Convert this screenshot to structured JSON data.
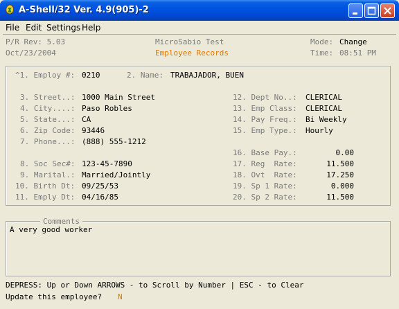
{
  "window": {
    "title": "A-Shell/32 Ver. 4.9(905)-2"
  },
  "menu": {
    "file": "File",
    "edit": "Edit",
    "settings": "Settings",
    "help": "Help"
  },
  "header": {
    "prrev": "P/R Rev: 5.03",
    "date": "Oct/23/2004",
    "company": "MicroSabio Test",
    "module": "Employee Records",
    "mode_label": "Mode:",
    "mode_value": "Change",
    "time_label": "Time:",
    "time_value": "08:51 PM"
  },
  "fields": {
    "f1": {
      "label": "^1. Employ #:",
      "value": "0210"
    },
    "f2": {
      "label": "2. Name:",
      "value": "TRABAJADOR, BUEN"
    },
    "f3": {
      "label": "3. Street..:",
      "value": "1000 Main Street"
    },
    "f4": {
      "label": "4. City....:",
      "value": "Paso Robles"
    },
    "f5": {
      "label": "5. State...:",
      "value": "CA"
    },
    "f6": {
      "label": "6. Zip Code:",
      "value": "93446"
    },
    "f7": {
      "label": "7. Phone...:",
      "value": "(888) 555-1212"
    },
    "f8": {
      "label": "8. Soc Sec#:",
      "value": "123-45-7890"
    },
    "f9": {
      "label": "9. Marital.:",
      "value": "Married/Jointly"
    },
    "f10": {
      "label": "10. Birth Dt:",
      "value": "09/25/53"
    },
    "f11": {
      "label": "11. Emply Dt:",
      "value": "04/16/85"
    },
    "f12": {
      "label": "12. Dept No..:",
      "value": "CLERICAL"
    },
    "f13": {
      "label": "13. Emp Class:",
      "value": "CLERICAL"
    },
    "f14": {
      "label": "14. Pay Freq.:",
      "value": "Bi Weekly"
    },
    "f15": {
      "label": "15. Emp Type.:",
      "value": "Hourly"
    },
    "f16": {
      "label": "16. Base Pay.:",
      "value": "0.00"
    },
    "f17": {
      "label": "17. Reg  Rate:",
      "value": "11.500"
    },
    "f18": {
      "label": "18. Ovt  Rate:",
      "value": "17.250"
    },
    "f19": {
      "label": "19. Sp 1 Rate:",
      "value": "0.000"
    },
    "f20": {
      "label": "20. Sp 2 Rate:",
      "value": "11.500"
    }
  },
  "comments": {
    "title": "Comments",
    "text": "A very good worker"
  },
  "footer": {
    "help": "DEPRESS: Up or Down ARROWS - to Scroll by Number | ESC - to Clear",
    "prompt": "Update this employee?",
    "answer": "N"
  }
}
